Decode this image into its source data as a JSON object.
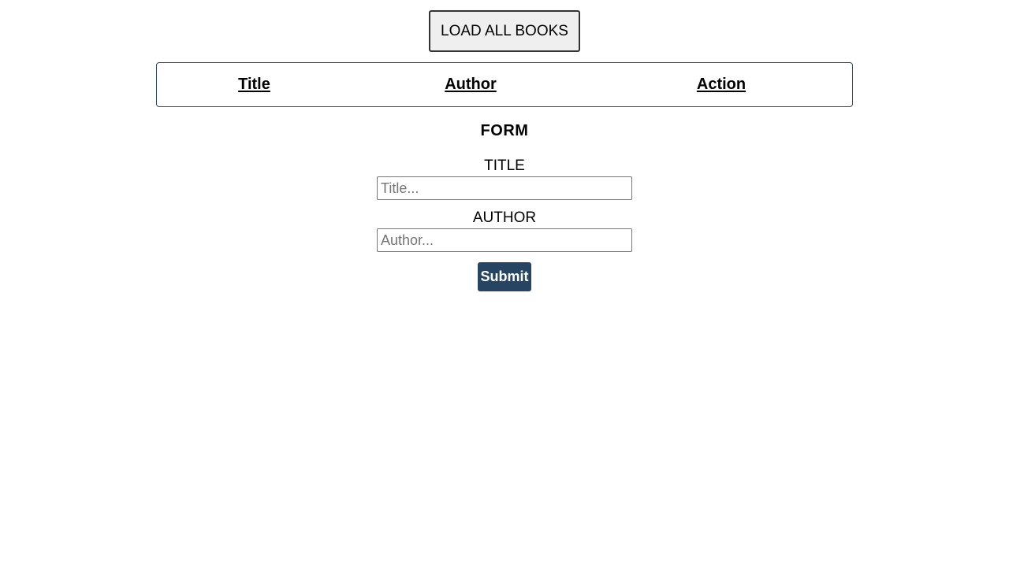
{
  "header": {
    "load_button_label": "LOAD ALL BOOKS"
  },
  "table": {
    "columns": [
      "Title",
      "Author",
      "Action"
    ],
    "rows": []
  },
  "form": {
    "heading": "FORM",
    "title_label": "TITLE",
    "title_placeholder": "Title...",
    "title_value": "",
    "author_label": "AUTHOR",
    "author_placeholder": "Author...",
    "author_value": "",
    "submit_label": "Submit"
  },
  "colors": {
    "accent": "#274563",
    "table_border": "#2c4866",
    "button_bg": "#efefef"
  }
}
